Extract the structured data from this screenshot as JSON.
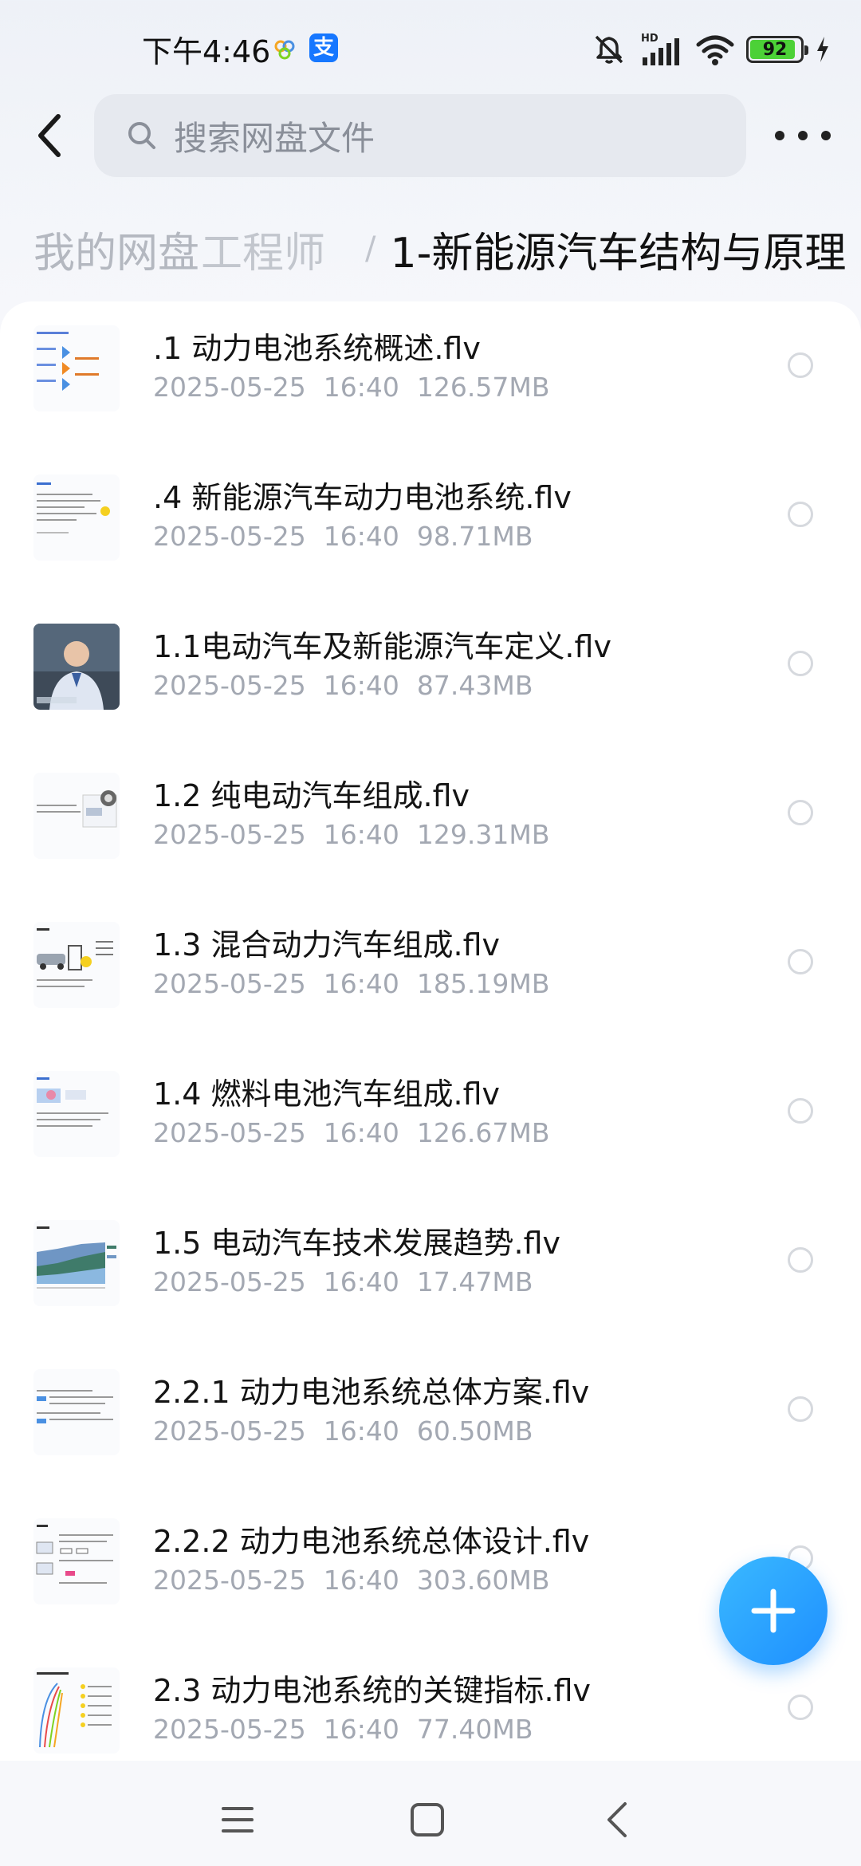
{
  "status_bar": {
    "time": "下午4:46",
    "alipay_glyph": "支",
    "battery_level": "92",
    "icons": [
      "colorful-dots-icon",
      "alipay-icon",
      "mute-icon",
      "hd-signal-icon",
      "wifi-icon",
      "battery-icon",
      "charging-icon"
    ]
  },
  "header": {
    "search_placeholder": "搜索网盘文件",
    "back_icon": "chevron-left-icon",
    "more_icon": "more-dots-icon"
  },
  "breadcrumb": {
    "root": "我的网盘",
    "middle": "工程师",
    "separator": "/",
    "current": "1-新能源汽车结构与原理"
  },
  "files": [
    {
      "name": ".1 动力电池系统概述.flv",
      "date": "2025-05-25",
      "time": "16:40",
      "size": "126.57MB"
    },
    {
      "name": ".4 新能源汽车动力电池系统.flv",
      "date": "2025-05-25",
      "time": "16:40",
      "size": "98.71MB"
    },
    {
      "name": "1.1电动汽车及新能源汽车定义.flv",
      "date": "2025-05-25",
      "time": "16:40",
      "size": "87.43MB"
    },
    {
      "name": "1.2 纯电动汽车组成.flv",
      "date": "2025-05-25",
      "time": "16:40",
      "size": "129.31MB"
    },
    {
      "name": "1.3 混合动力汽车组成.flv",
      "date": "2025-05-25",
      "time": "16:40",
      "size": "185.19MB"
    },
    {
      "name": "1.4 燃料电池汽车组成.flv",
      "date": "2025-05-25",
      "time": "16:40",
      "size": "126.67MB"
    },
    {
      "name": "1.5 电动汽车技术发展趋势.flv",
      "date": "2025-05-25",
      "time": "16:40",
      "size": "17.47MB"
    },
    {
      "name": "2.2.1 动力电池系统总体方案.flv",
      "date": "2025-05-25",
      "time": "16:40",
      "size": "60.50MB"
    },
    {
      "name": "2.2.2 动力电池系统总体设计.flv",
      "date": "2025-05-25",
      "time": "16:40",
      "size": "303.60MB"
    },
    {
      "name": "2.3 动力电池系统的关键指标.flv",
      "date": "2025-05-25",
      "time": "16:40",
      "size": "77.40MB"
    }
  ],
  "fab": {
    "icon": "plus-icon"
  },
  "bottom_nav": {
    "icons": [
      "menu-icon",
      "home-square-icon",
      "back-triangle-icon"
    ]
  },
  "colors": {
    "accent": "#1e8fff",
    "meta_text": "#a3a8b2",
    "search_bg": "#e6e9ef"
  }
}
